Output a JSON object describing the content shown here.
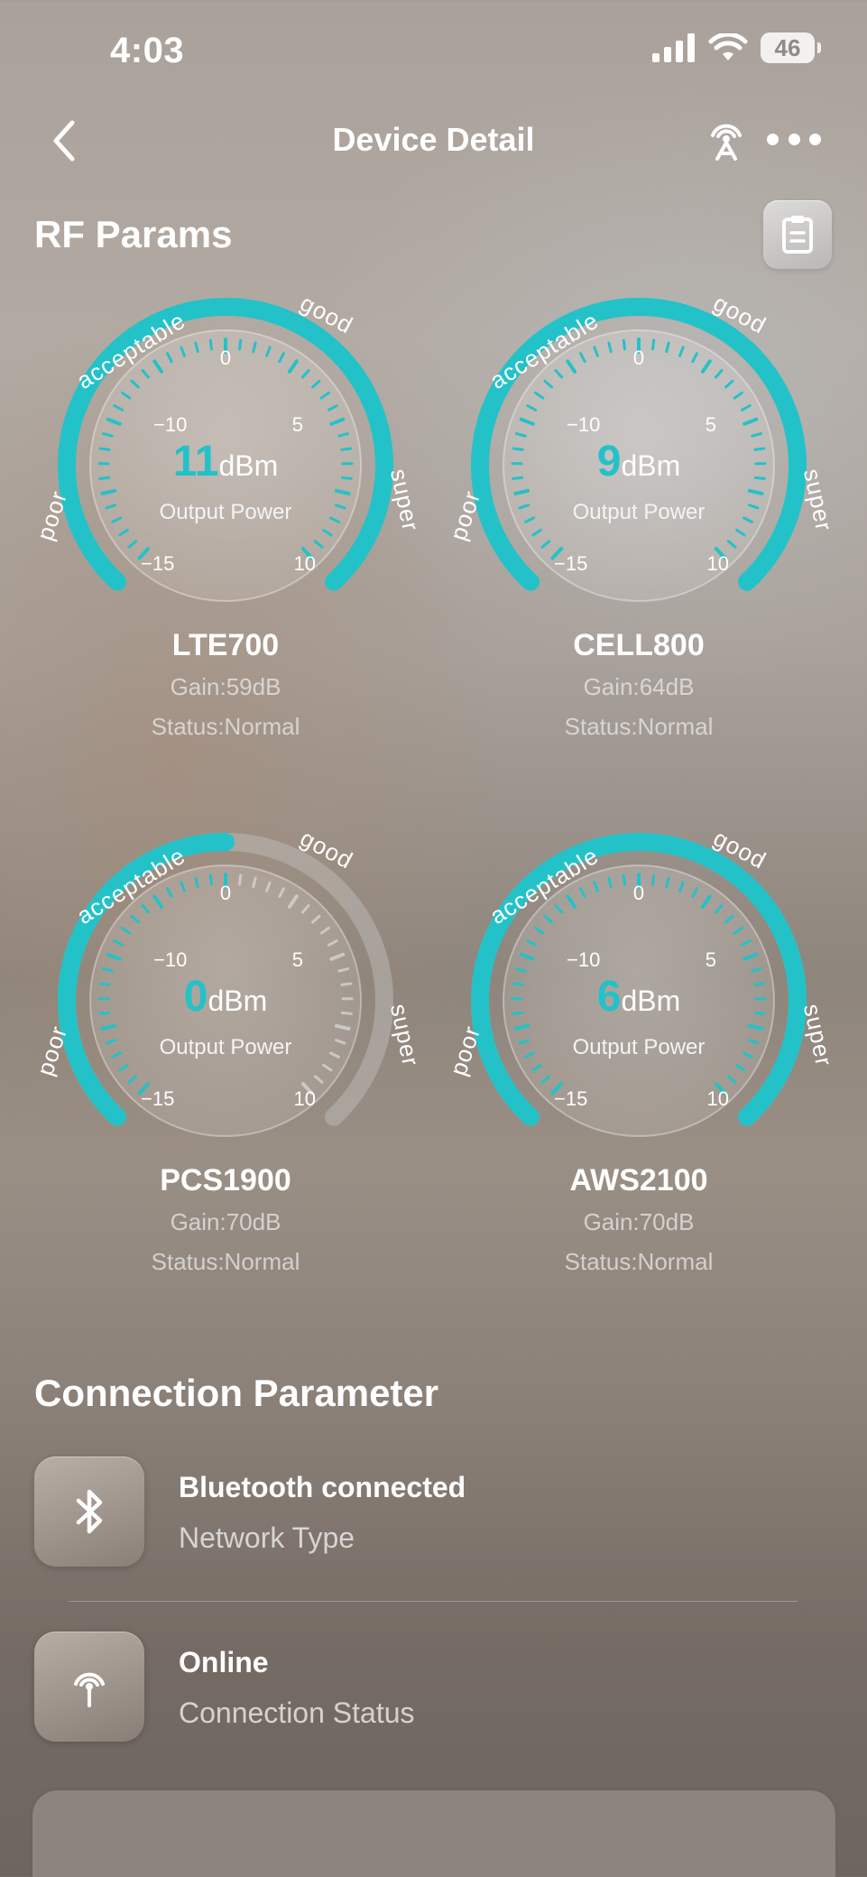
{
  "status_bar": {
    "time": "4:03",
    "battery": "46"
  },
  "nav": {
    "title": "Device Detail"
  },
  "rf": {
    "title": "RF Params",
    "zone_labels": {
      "poor": "poor",
      "acceptable": "acceptable",
      "good": "good",
      "super": "super"
    },
    "ticks": {
      "t0": "0",
      "tm10": "−10",
      "t5": "5",
      "tm15": "−15",
      "t10": "10"
    },
    "unit": "dBm",
    "metric_label": "Output Power",
    "bands": [
      {
        "name": "LTE700",
        "value": "11",
        "gain": "Gain:59dB",
        "status": "Status:Normal",
        "fill_fraction": 1.0
      },
      {
        "name": "CELL800",
        "value": "9",
        "gain": "Gain:64dB",
        "status": "Status:Normal",
        "fill_fraction": 1.0
      },
      {
        "name": "PCS1900",
        "value": "0",
        "gain": "Gain:70dB",
        "status": "Status:Normal",
        "fill_fraction": 0.5
      },
      {
        "name": "AWS2100",
        "value": "6",
        "gain": "Gain:70dB",
        "status": "Status:Normal",
        "fill_fraction": 1.0
      }
    ]
  },
  "connection": {
    "title": "Connection Parameter",
    "items": [
      {
        "title": "Bluetooth connected",
        "subtitle": "Network Type",
        "icon": "bluetooth-icon"
      },
      {
        "title": "Online",
        "subtitle": "Connection Status",
        "icon": "signal-tower-icon"
      }
    ]
  },
  "colors": {
    "accent": "#23c2c8",
    "track": "#bcb8b4"
  }
}
